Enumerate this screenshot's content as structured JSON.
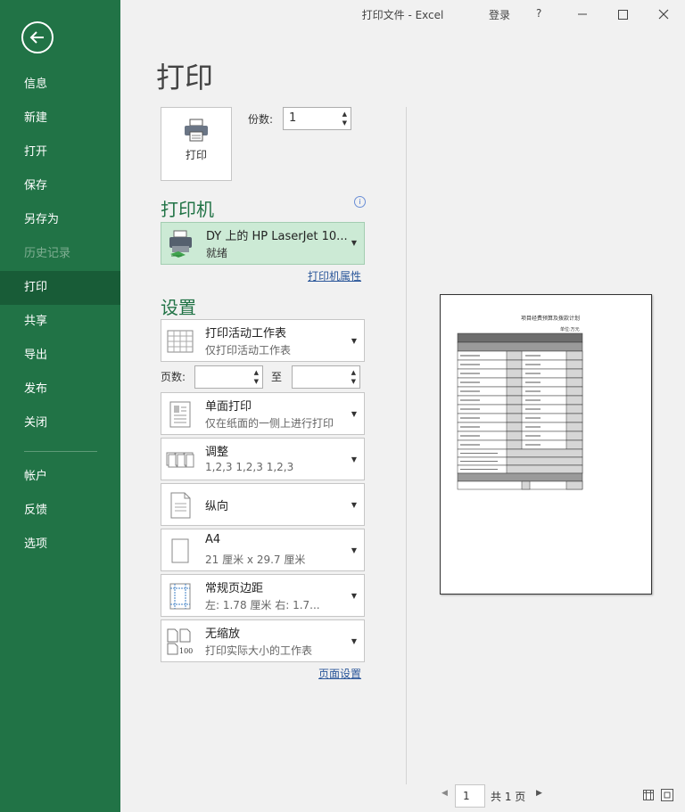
{
  "window": {
    "title": "打印文件  -  Excel",
    "login": "登录",
    "help": "?"
  },
  "sidebar": {
    "items": [
      {
        "label": "信息"
      },
      {
        "label": "新建"
      },
      {
        "label": "打开"
      },
      {
        "label": "保存"
      },
      {
        "label": "另存为"
      },
      {
        "label": "历史记录"
      },
      {
        "label": "打印"
      },
      {
        "label": "共享"
      },
      {
        "label": "导出"
      },
      {
        "label": "发布"
      },
      {
        "label": "关闭"
      },
      {
        "label": "帐户"
      },
      {
        "label": "反馈"
      },
      {
        "label": "选项"
      }
    ],
    "active": "打印",
    "disabled": "历史记录"
  },
  "main": {
    "title": "打印",
    "print_button": "打印",
    "copies_label": "份数:",
    "copies_value": "1",
    "printer_heading": "打印机",
    "printer_name": "DY 上的 HP LaserJet 10...",
    "printer_status": "就绪",
    "printer_properties": "打印机属性",
    "settings_heading": "设置",
    "settings": [
      {
        "t1": "打印活动工作表",
        "t2": "仅打印活动工作表"
      },
      {
        "t1": "单面打印",
        "t2": "仅在纸面的一侧上进行打印"
      },
      {
        "t1": "调整",
        "t2": "1,2,3    1,2,3    1,2,3"
      },
      {
        "t1": "纵向"
      },
      {
        "t1": "A4",
        "t2": "21 厘米 x 29.7 厘米"
      },
      {
        "t1": "常规页边距",
        "t2": "左: 1.78 厘米    右: 1.7..."
      },
      {
        "t1": "无缩放",
        "t2": "打印实际大小的工作表"
      }
    ],
    "pages_label": "页数:",
    "to_label": "至",
    "page_setup": "页面设置"
  },
  "preview": {
    "sheet_title": "项目经费预算及拨款计划",
    "unit": "单位:万元",
    "page_number": "1",
    "page_total": "共 1 页"
  },
  "colors": {
    "accent": "#217346",
    "active": "#185c37",
    "printer_bg": "#ccead5"
  }
}
